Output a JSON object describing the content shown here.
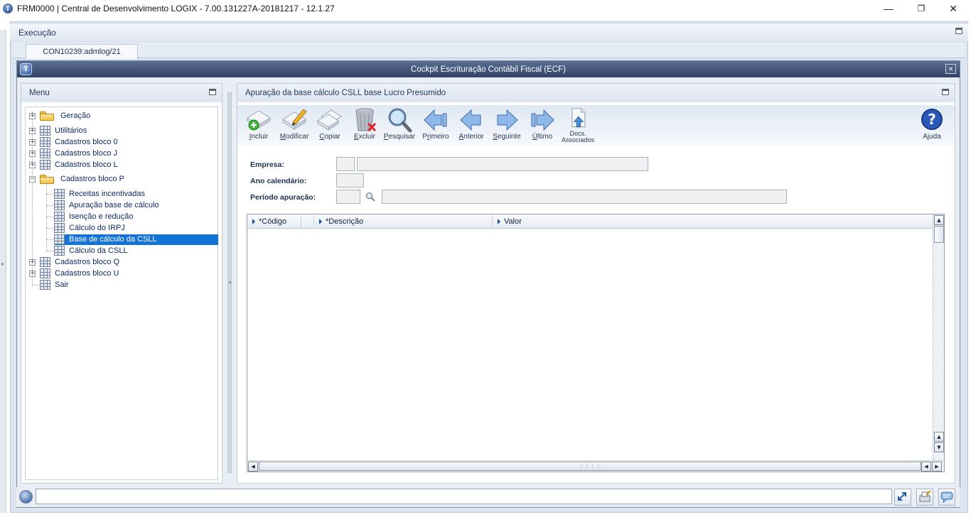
{
  "window": {
    "title": "FRM0000 | Central de Desenvolvimento LOGIX  -  7.00.131227A-20181217  -  12.1.27",
    "controls": {
      "minimize": "—",
      "restore": "❐",
      "close": "✕"
    }
  },
  "exec_bar": {
    "label": "Execução"
  },
  "tabs": [
    {
      "label": "CON10239:admlog/21"
    }
  ],
  "dialog": {
    "title": "Cockpit Escrituração Contábil Fiscal (ECF)",
    "close": "✕"
  },
  "menu": {
    "header": "Menu",
    "items": [
      {
        "label": "Geração",
        "type": "folder",
        "expanded": false
      },
      {
        "label": "Utilitários",
        "type": "grid",
        "expanded": false
      },
      {
        "label": "Cadastros bloco 0",
        "type": "grid",
        "expanded": false
      },
      {
        "label": "Cadastros bloco J",
        "type": "grid",
        "expanded": false
      },
      {
        "label": "Cadastros bloco L",
        "type": "grid",
        "expanded": false
      },
      {
        "label": "Cadastros bloco P",
        "type": "folder",
        "expanded": true
      },
      {
        "label": "Receitas incentivadas",
        "type": "grid",
        "level": 2
      },
      {
        "label": "Apuração base de cálculo",
        "type": "grid",
        "level": 2
      },
      {
        "label": "Isenção e redução",
        "type": "grid",
        "level": 2
      },
      {
        "label": "Cálculo do IRPJ",
        "type": "grid",
        "level": 2
      },
      {
        "label": "Base de cálculo da CSLL",
        "type": "grid",
        "level": 2,
        "selected": true
      },
      {
        "label": "Cálculo da CSLL",
        "type": "grid",
        "level": 2
      },
      {
        "label": "Cadastros bloco Q",
        "type": "grid",
        "expanded": false
      },
      {
        "label": "Cadastros bloco U",
        "type": "grid",
        "expanded": false
      },
      {
        "label": "Sair",
        "type": "grid"
      }
    ]
  },
  "content": {
    "header": "Apuração da base cálculo CSLL base Lucro Presumido",
    "toolbar": {
      "incluir": {
        "pre": "",
        "u": "I",
        "post": "ncluir"
      },
      "modificar": {
        "pre": "",
        "u": "M",
        "post": "odificar"
      },
      "copiar": {
        "pre": "",
        "u": "C",
        "post": "opiar"
      },
      "excluir": {
        "pre": "",
        "u": "E",
        "post": "xcluir"
      },
      "pesquisar": {
        "pre": "",
        "u": "P",
        "post": "esquisar"
      },
      "primeiro": {
        "pre": "P",
        "u": "r",
        "post": "imeiro"
      },
      "anterior": {
        "pre": "",
        "u": "A",
        "post": "nterior"
      },
      "seguinte": {
        "pre": "",
        "u": "S",
        "post": "eguinte"
      },
      "ultimo": {
        "pre": "",
        "u": "Ú",
        "post": "ltimo"
      },
      "docs_line1": "Docs.",
      "docs_line2": "Associados",
      "ajuda": "Ajuda"
    },
    "form": {
      "empresa_label": "Empresa:",
      "empresa_code": "",
      "empresa_name": "",
      "ano_label": "Ano calendário:",
      "ano_value": "",
      "periodo_label": "Período apuração:",
      "periodo_code": "",
      "periodo_desc": ""
    },
    "grid": {
      "columns": [
        "*Código",
        "*Descrição",
        "Valor"
      ],
      "rows": []
    }
  },
  "colors": {
    "title_gradient_top": "#5b6f93",
    "title_gradient_bottom": "#2f4266",
    "selection": "#1473d6",
    "link_text": "#0e2a66"
  }
}
